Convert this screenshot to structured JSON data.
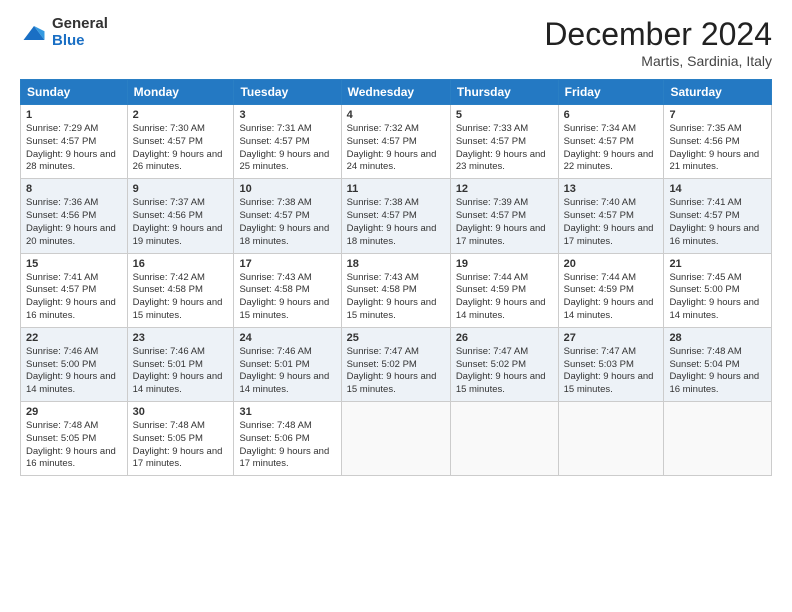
{
  "logo": {
    "general": "General",
    "blue": "Blue"
  },
  "header": {
    "title": "December 2024",
    "location": "Martis, Sardinia, Italy"
  },
  "days_of_week": [
    "Sunday",
    "Monday",
    "Tuesday",
    "Wednesday",
    "Thursday",
    "Friday",
    "Saturday"
  ],
  "weeks": [
    [
      {
        "day": "1",
        "sunrise": "7:29 AM",
        "sunset": "4:57 PM",
        "daylight": "9 hours and 28 minutes."
      },
      {
        "day": "2",
        "sunrise": "7:30 AM",
        "sunset": "4:57 PM",
        "daylight": "9 hours and 26 minutes."
      },
      {
        "day": "3",
        "sunrise": "7:31 AM",
        "sunset": "4:57 PM",
        "daylight": "9 hours and 25 minutes."
      },
      {
        "day": "4",
        "sunrise": "7:32 AM",
        "sunset": "4:57 PM",
        "daylight": "9 hours and 24 minutes."
      },
      {
        "day": "5",
        "sunrise": "7:33 AM",
        "sunset": "4:57 PM",
        "daylight": "9 hours and 23 minutes."
      },
      {
        "day": "6",
        "sunrise": "7:34 AM",
        "sunset": "4:57 PM",
        "daylight": "9 hours and 22 minutes."
      },
      {
        "day": "7",
        "sunrise": "7:35 AM",
        "sunset": "4:56 PM",
        "daylight": "9 hours and 21 minutes."
      }
    ],
    [
      {
        "day": "8",
        "sunrise": "7:36 AM",
        "sunset": "4:56 PM",
        "daylight": "9 hours and 20 minutes."
      },
      {
        "day": "9",
        "sunrise": "7:37 AM",
        "sunset": "4:56 PM",
        "daylight": "9 hours and 19 minutes."
      },
      {
        "day": "10",
        "sunrise": "7:38 AM",
        "sunset": "4:57 PM",
        "daylight": "9 hours and 18 minutes."
      },
      {
        "day": "11",
        "sunrise": "7:38 AM",
        "sunset": "4:57 PM",
        "daylight": "9 hours and 18 minutes."
      },
      {
        "day": "12",
        "sunrise": "7:39 AM",
        "sunset": "4:57 PM",
        "daylight": "9 hours and 17 minutes."
      },
      {
        "day": "13",
        "sunrise": "7:40 AM",
        "sunset": "4:57 PM",
        "daylight": "9 hours and 17 minutes."
      },
      {
        "day": "14",
        "sunrise": "7:41 AM",
        "sunset": "4:57 PM",
        "daylight": "9 hours and 16 minutes."
      }
    ],
    [
      {
        "day": "15",
        "sunrise": "7:41 AM",
        "sunset": "4:57 PM",
        "daylight": "9 hours and 16 minutes."
      },
      {
        "day": "16",
        "sunrise": "7:42 AM",
        "sunset": "4:58 PM",
        "daylight": "9 hours and 15 minutes."
      },
      {
        "day": "17",
        "sunrise": "7:43 AM",
        "sunset": "4:58 PM",
        "daylight": "9 hours and 15 minutes."
      },
      {
        "day": "18",
        "sunrise": "7:43 AM",
        "sunset": "4:58 PM",
        "daylight": "9 hours and 15 minutes."
      },
      {
        "day": "19",
        "sunrise": "7:44 AM",
        "sunset": "4:59 PM",
        "daylight": "9 hours and 14 minutes."
      },
      {
        "day": "20",
        "sunrise": "7:44 AM",
        "sunset": "4:59 PM",
        "daylight": "9 hours and 14 minutes."
      },
      {
        "day": "21",
        "sunrise": "7:45 AM",
        "sunset": "5:00 PM",
        "daylight": "9 hours and 14 minutes."
      }
    ],
    [
      {
        "day": "22",
        "sunrise": "7:46 AM",
        "sunset": "5:00 PM",
        "daylight": "9 hours and 14 minutes."
      },
      {
        "day": "23",
        "sunrise": "7:46 AM",
        "sunset": "5:01 PM",
        "daylight": "9 hours and 14 minutes."
      },
      {
        "day": "24",
        "sunrise": "7:46 AM",
        "sunset": "5:01 PM",
        "daylight": "9 hours and 14 minutes."
      },
      {
        "day": "25",
        "sunrise": "7:47 AM",
        "sunset": "5:02 PM",
        "daylight": "9 hours and 15 minutes."
      },
      {
        "day": "26",
        "sunrise": "7:47 AM",
        "sunset": "5:02 PM",
        "daylight": "9 hours and 15 minutes."
      },
      {
        "day": "27",
        "sunrise": "7:47 AM",
        "sunset": "5:03 PM",
        "daylight": "9 hours and 15 minutes."
      },
      {
        "day": "28",
        "sunrise": "7:48 AM",
        "sunset": "5:04 PM",
        "daylight": "9 hours and 16 minutes."
      }
    ],
    [
      {
        "day": "29",
        "sunrise": "7:48 AM",
        "sunset": "5:05 PM",
        "daylight": "9 hours and 16 minutes."
      },
      {
        "day": "30",
        "sunrise": "7:48 AM",
        "sunset": "5:05 PM",
        "daylight": "9 hours and 17 minutes."
      },
      {
        "day": "31",
        "sunrise": "7:48 AM",
        "sunset": "5:06 PM",
        "daylight": "9 hours and 17 minutes."
      },
      null,
      null,
      null,
      null
    ]
  ],
  "labels": {
    "sunrise": "Sunrise:",
    "sunset": "Sunset:",
    "daylight": "Daylight:"
  }
}
